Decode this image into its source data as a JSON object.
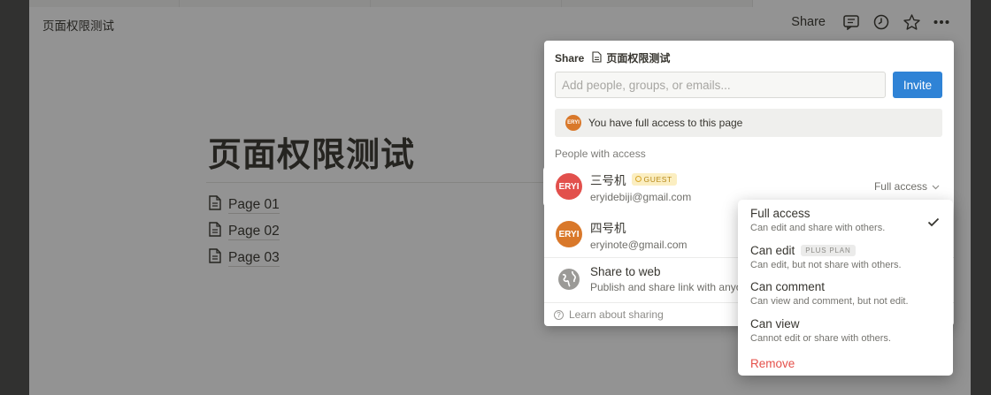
{
  "window": {
    "breadcrumb": "页面权限测试",
    "share_label": "Share",
    "icons": [
      "comment-icon",
      "clock-icon",
      "star-icon",
      "more-icon"
    ]
  },
  "page": {
    "title": "页面权限测试",
    "subpages": [
      {
        "label": "Page 01"
      },
      {
        "label": "Page 02"
      },
      {
        "label": "Page 03"
      }
    ]
  },
  "share_panel": {
    "header_label": "Share",
    "doc_title": "页面权限测试",
    "invite_placeholder": "Add people, groups, or emails...",
    "invite_button": "Invite",
    "notice": "You have full access to this page",
    "notice_avatar": "ERYI",
    "section_label": "People with access",
    "people": [
      {
        "avatar": "ERYI",
        "avatar_color": "#e2504c",
        "name": "三号机",
        "badge": "GUEST",
        "email": "eryidebiji@gmail.com",
        "access": "Full access"
      },
      {
        "avatar": "ERYI",
        "avatar_color": "#d9782a",
        "name": "四号机",
        "email": "eryinote@gmail.com"
      }
    ],
    "web": {
      "title": "Share to web",
      "desc": "Publish and share link with anyone"
    },
    "footer": "Learn about sharing"
  },
  "access_menu": {
    "options": [
      {
        "title": "Full access",
        "desc": "Can edit and share with others.",
        "selected": true
      },
      {
        "title": "Can edit",
        "badge": "PLUS PLAN",
        "desc": "Can edit, but not share with others."
      },
      {
        "title": "Can comment",
        "desc": "Can view and comment, but not edit."
      },
      {
        "title": "Can view",
        "desc": "Cannot edit or share with others."
      }
    ],
    "remove": "Remove"
  },
  "colors": {
    "accent": "#2f83d6",
    "danger": "#e5504a",
    "guest_bg": "#fbeec1"
  }
}
